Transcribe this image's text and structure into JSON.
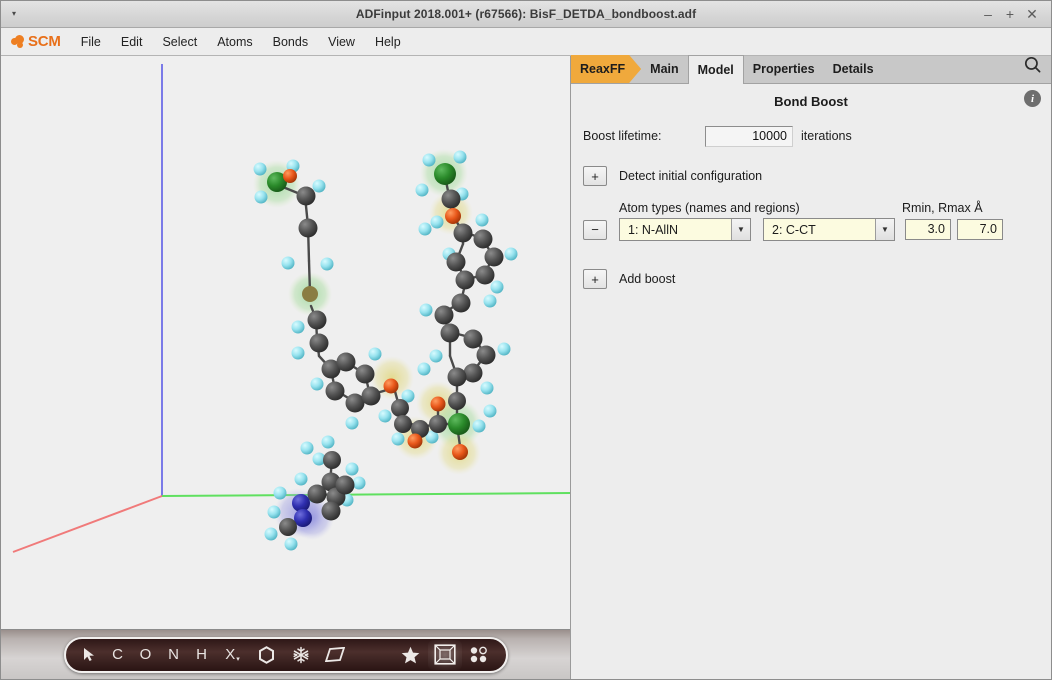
{
  "window": {
    "title": "ADFinput 2018.001+ (r67566): BisF_DETDA_bondboost.adf",
    "menu_arrow": "▾",
    "minimize": "–",
    "maximize": "+",
    "close": "✕"
  },
  "menubar": {
    "logo_text": "SCM",
    "items": [
      {
        "label": "File"
      },
      {
        "label": "Edit"
      },
      {
        "label": "Select"
      },
      {
        "label": "Atoms"
      },
      {
        "label": "Bonds"
      },
      {
        "label": "View"
      },
      {
        "label": "Help"
      }
    ]
  },
  "tabs": [
    {
      "label": "ReaxFF",
      "style": "pill",
      "active": false
    },
    {
      "label": "Main",
      "style": "plain",
      "active": false
    },
    {
      "label": "Model",
      "style": "plain",
      "active": true
    },
    {
      "label": "Properties",
      "style": "plain",
      "active": false
    },
    {
      "label": "Details",
      "style": "plain",
      "active": false
    }
  ],
  "panel": {
    "title": "Bond Boost",
    "info_glyph": "i",
    "boost_lifetime_label": "Boost lifetime:",
    "boost_lifetime_value": "10000",
    "boost_lifetime_unit": "iterations",
    "detect_button": "+",
    "detect_label": "Detect initial configuration",
    "atom_types_header": "Atom types (names and regions)",
    "rminmax_header": "Rmin, Rmax Å",
    "boost_rows": [
      {
        "remove_button": "−",
        "atom_type_1": "1: N-AllN",
        "atom_type_2": "2: C-CT",
        "rmin": "3.0",
        "rmax": "7.0",
        "dropdown_arrow": "▼"
      }
    ],
    "add_button": "+",
    "add_label": "Add boost"
  },
  "toolbar": {
    "tools": [
      {
        "name": "select-arrow",
        "glyph": "arrow",
        "selected": false
      },
      {
        "name": "carbon",
        "glyph": "C",
        "selected": false
      },
      {
        "name": "oxygen",
        "glyph": "O",
        "selected": false
      },
      {
        "name": "nitrogen",
        "glyph": "N",
        "selected": false
      },
      {
        "name": "hydrogen",
        "glyph": "H",
        "selected": false
      },
      {
        "name": "other-element",
        "glyph": "X",
        "selected": false,
        "caret": "▾"
      },
      {
        "name": "benzene-ring",
        "glyph": "hexagon",
        "selected": false
      },
      {
        "name": "fragment",
        "glyph": "snowflake",
        "selected": false
      },
      {
        "name": "plane",
        "glyph": "parallelogram",
        "selected": false
      },
      {
        "name": "favorites",
        "glyph": "star",
        "selected": false
      },
      {
        "name": "unit-cell",
        "glyph": "cell",
        "selected": true
      },
      {
        "name": "grid-points",
        "glyph": "dots",
        "selected": false
      }
    ]
  },
  "viewport": {
    "axes": [
      {
        "name": "x-axis",
        "color": "#f06a6a"
      },
      {
        "name": "y-axis",
        "color": "#56df56"
      },
      {
        "name": "z-axis",
        "color": "#6f6fe8"
      }
    ],
    "background": "#efefef",
    "atom_colors": {
      "carbon": "#4d4d4d",
      "hydrogen": "#8fe3ef",
      "oxygen": "#e1571b",
      "nitrogen": "#3535b8",
      "highlight_green": "#2d8a2d",
      "halo_green": "#8fc98f",
      "halo_yellow": "#d9d27a",
      "halo_blue": "#8a8ad8"
    }
  }
}
